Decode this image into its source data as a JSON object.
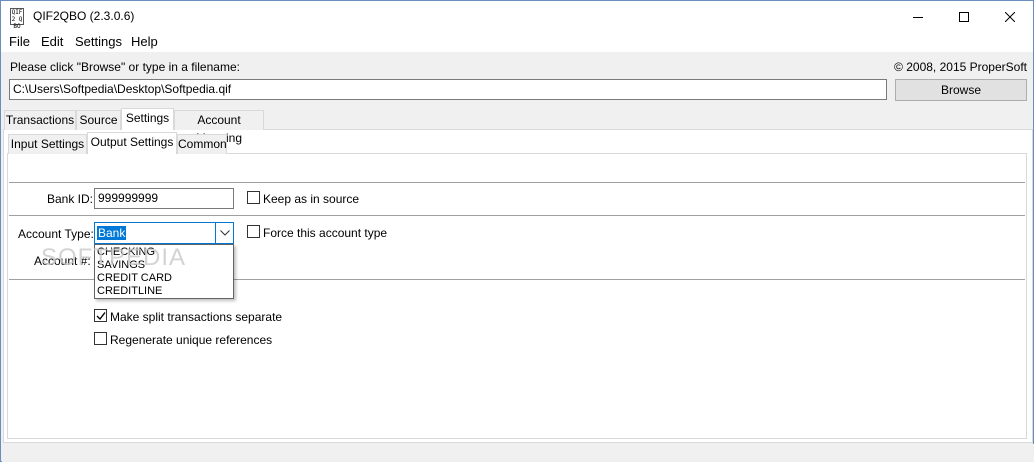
{
  "window": {
    "title": "QIF2QBO (2.3.0.6)",
    "icon_text": "QIF 2 QBO",
    "controls": {
      "minimize": "minimize-icon",
      "maximize": "maximize-icon",
      "close": "close-icon"
    }
  },
  "menu": {
    "items": [
      {
        "label": "File"
      },
      {
        "label": "Edit"
      },
      {
        "label": "Settings"
      },
      {
        "label": "Help"
      }
    ]
  },
  "file_row": {
    "prompt": "Please click \"Browse\" or type in a filename:",
    "copyright": "© 2008, 2015 ProperSoft",
    "path_value": "C:\\Users\\Softpedia\\Desktop\\Softpedia.qif",
    "browse_label": "Browse"
  },
  "main_tabs": [
    {
      "label": "Transactions",
      "active": false
    },
    {
      "label": "Source",
      "active": false
    },
    {
      "label": "Settings",
      "active": true
    },
    {
      "label": "Account Mapping",
      "active": false
    }
  ],
  "sub_tabs": [
    {
      "label": "Input Settings",
      "active": false
    },
    {
      "label": "Output Settings",
      "active": true
    },
    {
      "label": "Common",
      "active": false
    }
  ],
  "output_settings": {
    "bank_id_label": "Bank ID:",
    "bank_id_value": "999999999",
    "keep_as_source_label": "Keep as in source",
    "keep_as_source_checked": false,
    "account_type_label": "Account Type:",
    "account_type_value": "Bank",
    "account_type_options": [
      "CHECKING",
      "SAVINGS",
      "CREDIT CARD",
      "CREDITLINE"
    ],
    "force_type_label": "Force this account type",
    "force_type_checked": false,
    "account_num_label": "Account #:",
    "split_label": "Make split transactions separate",
    "split_checked": true,
    "regen_label": "Regenerate unique references",
    "regen_checked": false
  },
  "watermark": "SOFTPEDIA",
  "colors": {
    "accent": "#0078d7",
    "window_bg": "#f0f0f0",
    "panel_bg": "#ffffff"
  }
}
